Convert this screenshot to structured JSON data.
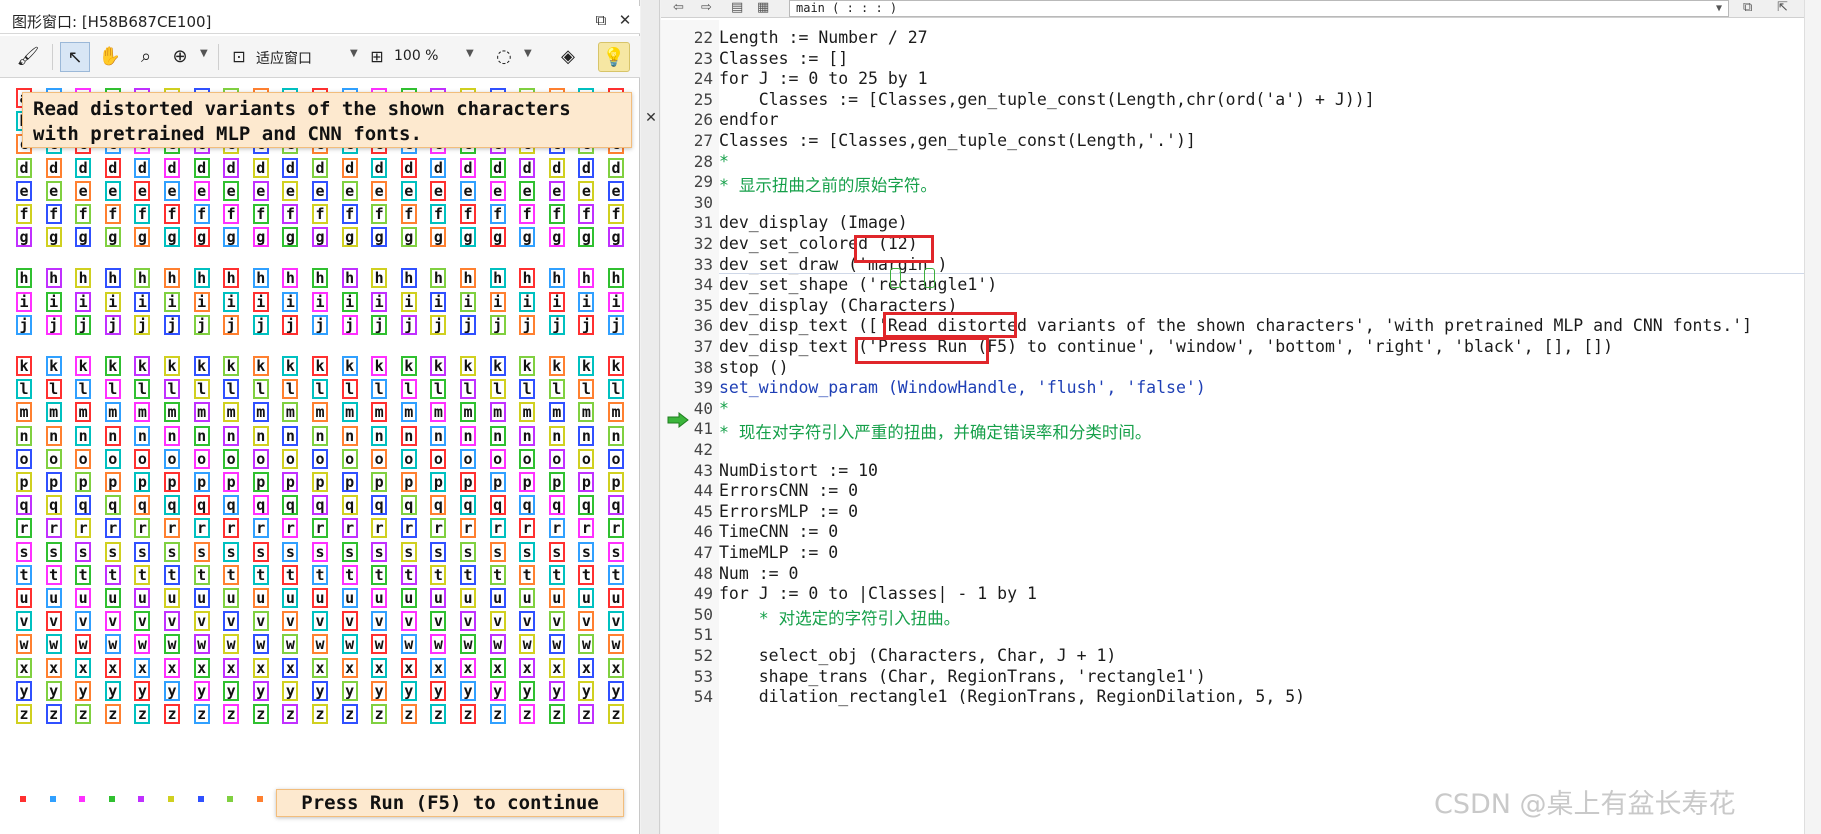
{
  "graphics_window": {
    "title": "图形窗口: [H58B687CE100]",
    "toolbar": {
      "fit_label": "适应窗口",
      "zoom_label": "100 %"
    },
    "char_rows": [
      "aaaaaaaaaaaaaaaaaaaaa",
      "bbbbbbbbbbbbbbbbbbbbb",
      "ccccccccccccccccccccc",
      "ddddddddddddddddddddd",
      "eeeeeeeeeeeeeeeeeeeee",
      "fffffffffffffffffffff",
      "ggggggggggggggggggggg",
      "hhhhhhhhhhhhhhhhhhhhh",
      "iiiiiiiiiiiiiiiiiiiii",
      "jjjjjjjjjjjjjjjjjjjjj",
      "kkkkkkkkkkkkkkkkkkkkk",
      "lllllllllllllllllllll",
      "mmmmmmmmmmmmmmmmmmmmm",
      "nnnnnnnnnnnnnnnnnnnnn",
      "ooooooooooooooooooooo",
      "ppppppppppppppppppppp",
      "qqqqqqqqqqqqqqqqqqqqq",
      "rrrrrrrrrrrrrrrrrrrrr",
      "sssssssssssssssssssss",
      "ttttttttttttttttttttt",
      "uuuuuuuuuuuuuuuuuuuuu",
      "vvvvvvvvvvvvvvvvvvvvv",
      "wwwwwwwwwwwwwwwwwwwww",
      "xxxxxxxxxxxxxxxxxxxxx",
      "yyyyyyyyyyyyyyyyyyyyy",
      "zzzzzzzzzzzzzzzzzzzzz"
    ],
    "message_top_line1": "Read distorted variants of the shown characters",
    "message_top_line2": "with pretrained MLP and CNN fonts.",
    "message_bottom": "Press Run (F5) to continue",
    "colors": [
      "#ff3030",
      "#30c030",
      "#3050ff",
      "#00c0c0",
      "#ff30ff",
      "#d0d020",
      "#ff8030",
      "#30a0ff",
      "#c030ff",
      "#80d040"
    ]
  },
  "editor": {
    "procedure": "main ( : : : )",
    "lines": [
      {
        "n": "22",
        "text": "Length := Number / 27",
        "style": "kw"
      },
      {
        "n": "23",
        "text": "Classes := []",
        "style": "kw"
      },
      {
        "n": "24",
        "text": "for J := 0 to 25 by 1",
        "style": "kw"
      },
      {
        "n": "25",
        "text": "    Classes := [Classes,gen_tuple_const(Length,chr(ord('a') + J))]",
        "style": "kw"
      },
      {
        "n": "26",
        "text": "endfor",
        "style": "kw"
      },
      {
        "n": "27",
        "text": "Classes := [Classes,gen_tuple_const(Length,'.')]",
        "style": "kw"
      },
      {
        "n": "28",
        "text": "*",
        "style": "comment"
      },
      {
        "n": "29",
        "text": "* 显示扭曲之前的原始字符。",
        "style": "comment"
      },
      {
        "n": "30",
        "text": "",
        "style": "kw"
      },
      {
        "n": "31",
        "text": "dev_display (Image)",
        "style": "kw"
      },
      {
        "n": "32",
        "text": "dev_set_colored (12)",
        "style": "kw"
      },
      {
        "n": "33",
        "text": "dev_set_draw ('margin')",
        "style": "kw"
      },
      {
        "n": "34",
        "text": "dev_set_shape ('rectangle1')",
        "style": "kw"
      },
      {
        "n": "35",
        "text": "dev_display (Characters)",
        "style": "kw"
      },
      {
        "n": "36",
        "text": "dev_disp_text (['Read distorted variants of the shown characters', 'with pretrained MLP and CNN fonts.']",
        "style": "kw"
      },
      {
        "n": "37",
        "text": "dev_disp_text ('Press Run (F5) to continue', 'window', 'bottom', 'right', 'black', [], [])",
        "style": "kw"
      },
      {
        "n": "38",
        "text": "stop ()",
        "style": "kw"
      },
      {
        "n": "39",
        "text": "set_window_param (WindowHandle, 'flush', 'false')",
        "style": "blue"
      },
      {
        "n": "40",
        "text": "*",
        "style": "comment"
      },
      {
        "n": "41",
        "text": "* 现在对字符引入严重的扭曲，并确定错误率和分类时间。",
        "style": "comment"
      },
      {
        "n": "42",
        "text": "",
        "style": "kw"
      },
      {
        "n": "43",
        "text": "NumDistort := 10",
        "style": "kw"
      },
      {
        "n": "44",
        "text": "ErrorsCNN := 0",
        "style": "kw"
      },
      {
        "n": "45",
        "text": "ErrorsMLP := 0",
        "style": "kw"
      },
      {
        "n": "46",
        "text": "TimeCNN := 0",
        "style": "kw"
      },
      {
        "n": "47",
        "text": "TimeMLP := 0",
        "style": "kw"
      },
      {
        "n": "48",
        "text": "Num := 0",
        "style": "kw"
      },
      {
        "n": "49",
        "text": "for J := 0 to |Classes| - 1 by 1",
        "style": "kw"
      },
      {
        "n": "50",
        "text": "    * 对选定的字符引入扭曲。",
        "style": "comment"
      },
      {
        "n": "51",
        "text": "",
        "style": "kw"
      },
      {
        "n": "52",
        "text": "    select_obj (Characters, Char, J + 1)",
        "style": "kw"
      },
      {
        "n": "53",
        "text": "    shape_trans (Char, RegionTrans, 'rectangle1')",
        "style": "kw"
      },
      {
        "n": "54",
        "text": "    dilation_rectangle1 (RegionTrans, RegionDilation, 5, 5)",
        "style": "kw"
      }
    ],
    "watermark": "CSDN @桌上有盆长寿花",
    "highlight_color": "#e0262a"
  }
}
